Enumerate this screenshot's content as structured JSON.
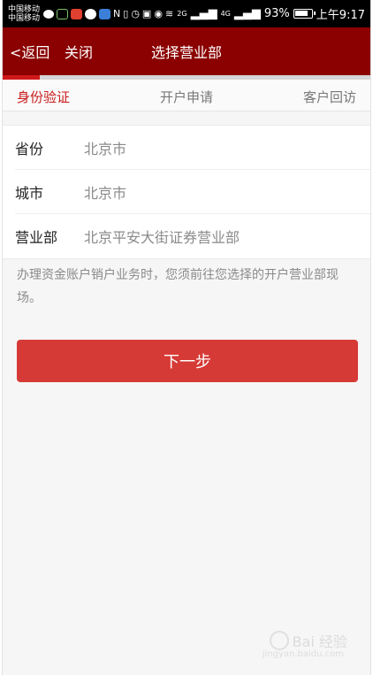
{
  "status_bar": {
    "carrier_1": "中国移动",
    "carrier_2": "中国移动",
    "signal_tag_1": "2G",
    "signal_tag_2": "4G",
    "battery": "93%",
    "time": "上午9:17"
  },
  "nav": {
    "back_label": "<返回",
    "close_label": "关闭",
    "title": "选择营业部"
  },
  "progress": {
    "fraction": 0.1
  },
  "steps": [
    {
      "label": "身份验证",
      "active": true
    },
    {
      "label": "开户申请",
      "active": false
    },
    {
      "label": "客户回访",
      "active": false
    }
  ],
  "form": {
    "province": {
      "label": "省份",
      "value": "北京市"
    },
    "city": {
      "label": "城市",
      "value": "北京市"
    },
    "branch": {
      "label": "营业部",
      "value": "北京平安大街证券营业部"
    }
  },
  "notice": "办理资金账户销户业务时，您须前往您选择的开户营业部现场。",
  "next_button": "下一步",
  "watermark": {
    "text": "Bai 经验",
    "sub": "jingyan.baidu.com"
  },
  "colors": {
    "nav_bg": "#8b0000",
    "accent": "#c81a1a",
    "button": "#d63a36"
  }
}
